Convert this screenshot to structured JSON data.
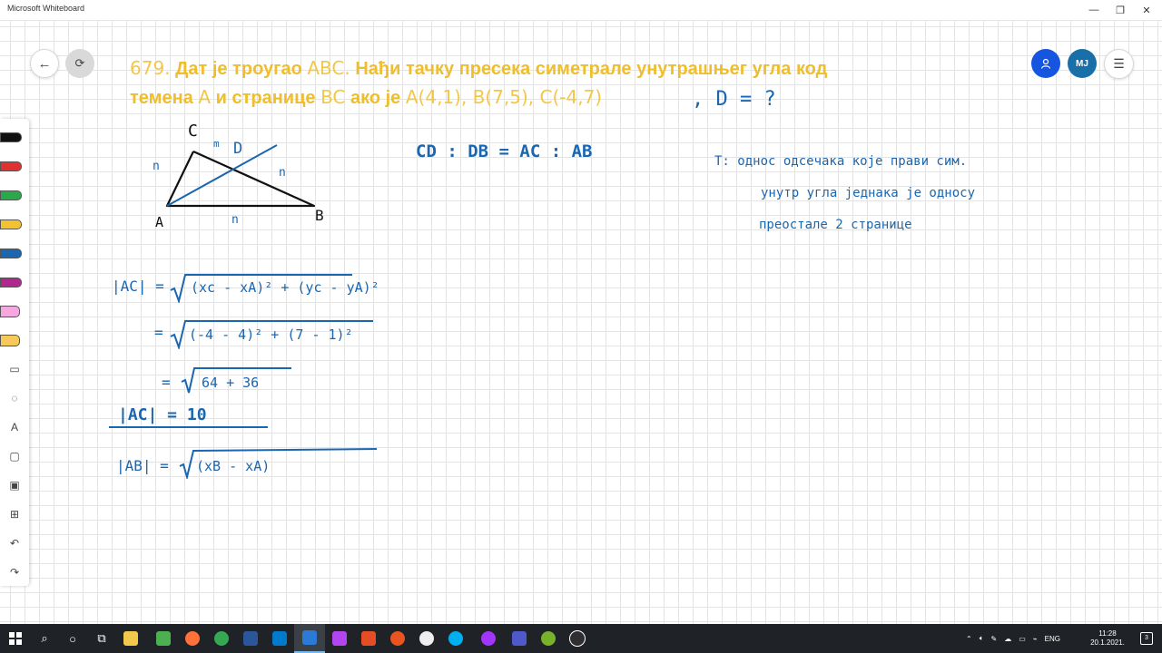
{
  "window": {
    "title": "Microsoft Whiteboard"
  },
  "top_right": {
    "avatar_initials": "MJ"
  },
  "problem": {
    "number": "679.",
    "line1_a": "Дат је троугао",
    "line1_b": "ABC.",
    "line1_c": "Нађи тачку пресека симетрале унутрашњег угла код",
    "line2_a": "темена",
    "line2_b": "A",
    "line2_c": "и странице",
    "line2_d": "BC",
    "line2_e": "ако је",
    "line2_f": "A(4,1), B(7,5), C(-4,7)",
    "question": ",  D = ?"
  },
  "figure": {
    "label_a": "A",
    "label_b": "B",
    "label_c": "C",
    "label_d": "D",
    "mark_ac": "n",
    "mark_cd": "m",
    "mark_db": "n",
    "mark_ab": "n"
  },
  "handwriting": {
    "ratio": "CD : DB = AC : AB",
    "theorem_1": "T:  однос одсечака које прави сим.",
    "theorem_2": "унутр угла једнака је односу",
    "theorem_3": "преосталe 2 странице",
    "ac_line1_lhs": "|AC| =",
    "ac_line1_rad": "(xc - xA)² + (yc - yA)²",
    "ac_line2_lhs": "=",
    "ac_line2_rad": "(-4 - 4)² + (7 - 1)²",
    "ac_line3_lhs": "=",
    "ac_line3_rad": "64 + 36",
    "ac_result": "|AC| = 10",
    "ab_line1_lhs": "|AB| =",
    "ab_line1_rad": "(xB - xA)"
  },
  "taskbar": {
    "language": "ENG",
    "time": "11:28",
    "date": "20.1.2021.",
    "notification_count": "3"
  },
  "colors": {
    "heading": "#f0be2c",
    "ink_blue": "#1a66b0",
    "accent": "#1655e0",
    "taskbar": "#1f2327"
  },
  "icons": [
    "back-arrow-icon",
    "share-icon",
    "person-icon",
    "menu-icon",
    "pen-icon",
    "highlighter-icon",
    "eraser-icon",
    "ruler-icon",
    "lasso-icon",
    "text-icon",
    "note-icon",
    "image-icon",
    "add-icon",
    "undo-icon",
    "redo-icon",
    "windows-icon",
    "search-icon"
  ]
}
